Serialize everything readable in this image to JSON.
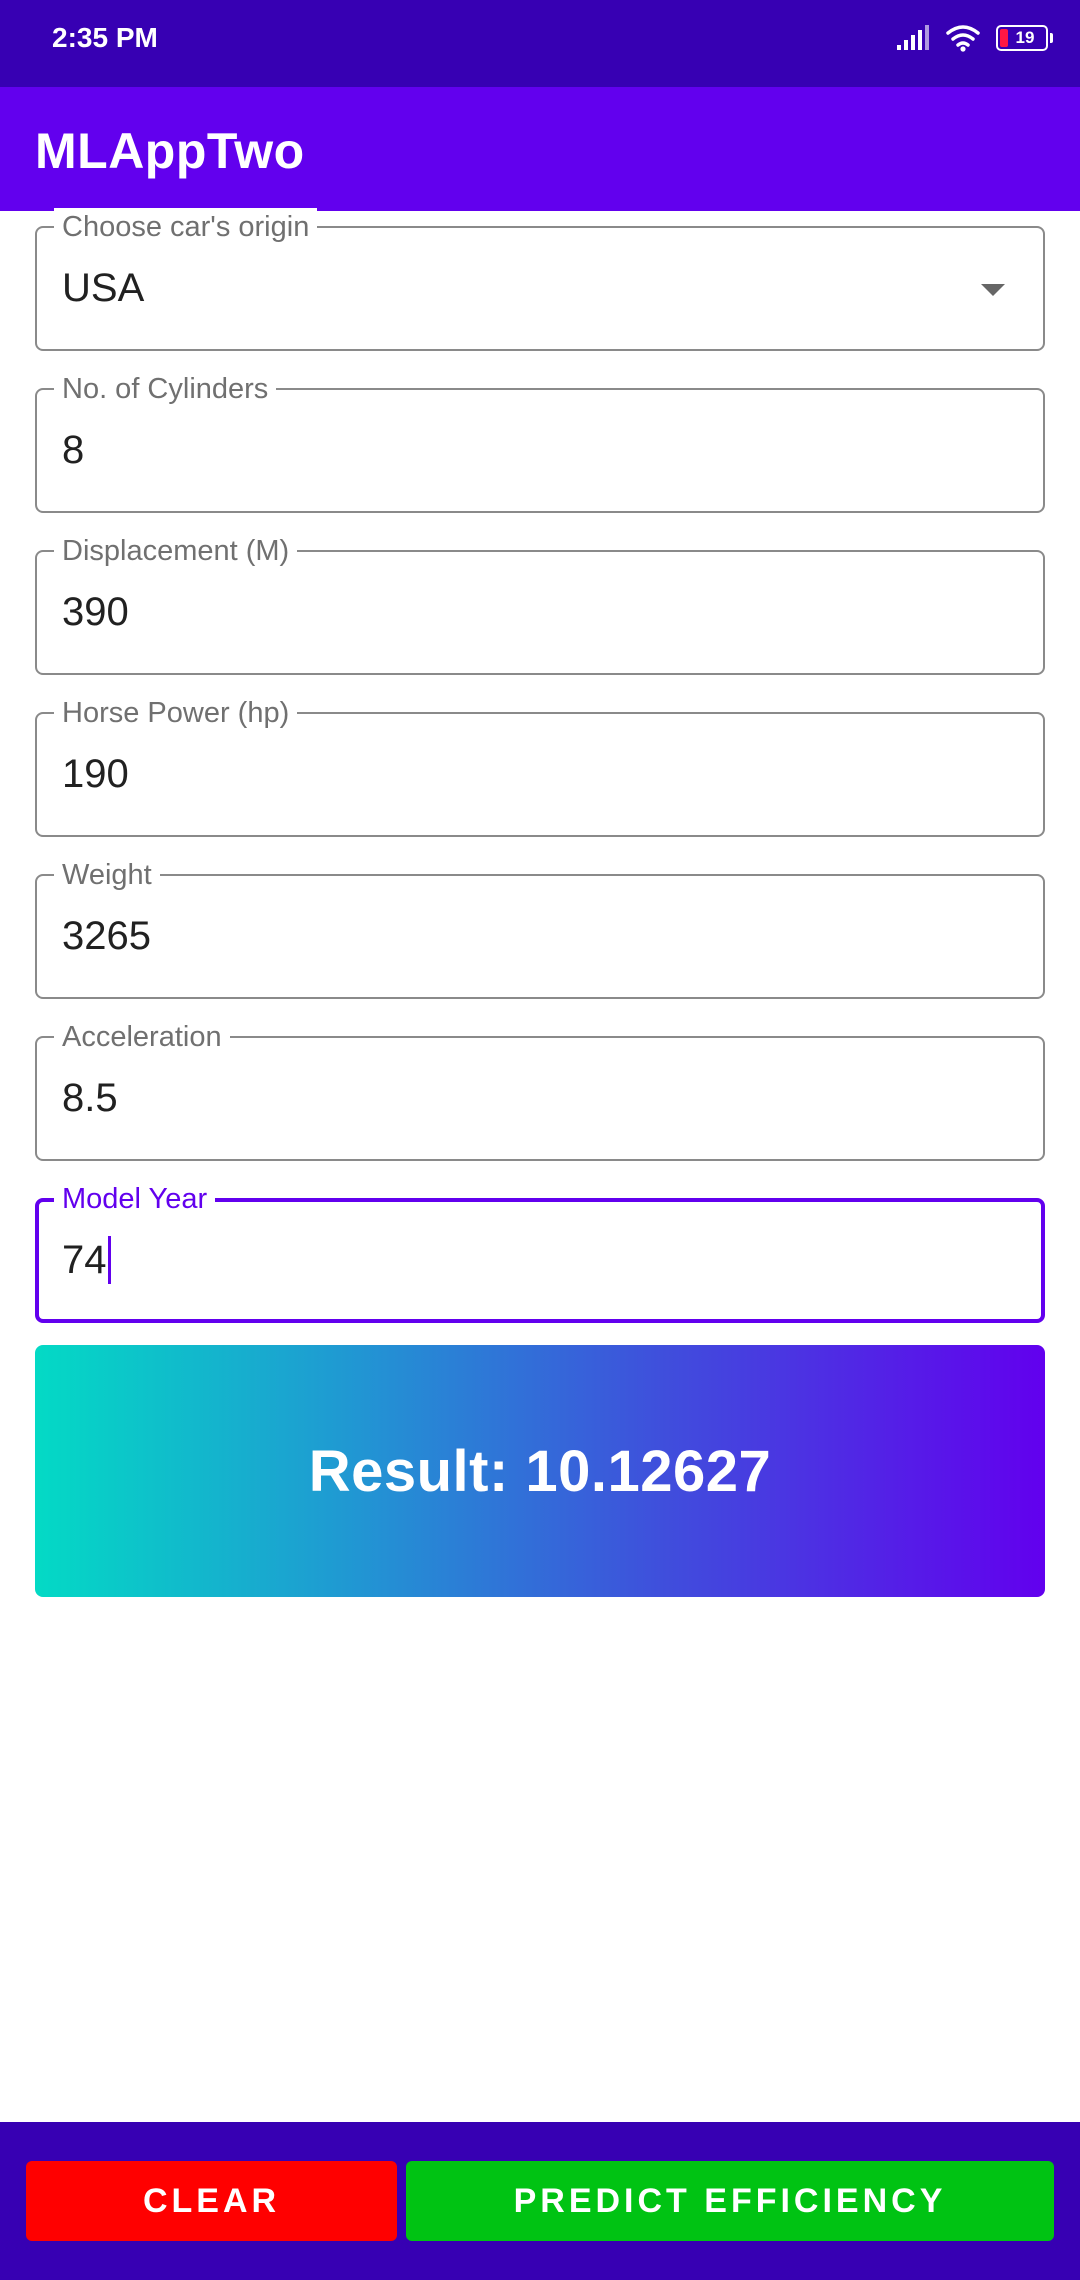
{
  "status_bar": {
    "time": "2:35 PM",
    "battery_level": "19",
    "icons": [
      "signal-icon",
      "wifi-icon",
      "battery-icon"
    ]
  },
  "app_bar": {
    "title": "MLAppTwo"
  },
  "form": {
    "fields": [
      {
        "label": "Choose car's origin",
        "value": "USA",
        "type": "dropdown"
      },
      {
        "label": "No. of Cylinders",
        "value": "8"
      },
      {
        "label": "Displacement (M)",
        "value": "390"
      },
      {
        "label": "Horse Power (hp)",
        "value": "190"
      },
      {
        "label": "Weight",
        "value": "3265"
      },
      {
        "label": "Acceleration",
        "value": "8.5"
      },
      {
        "label": "Model Year",
        "value": "74",
        "focused": true
      }
    ]
  },
  "result": {
    "text": "Result: 10.12627"
  },
  "actions": {
    "clear_label": "CLEAR",
    "predict_label": "PREDICT EFFICIENCY"
  },
  "colors": {
    "status_bar": "#3700b3",
    "primary": "#6200ee",
    "accent": "#03dac5",
    "clear_button": "#ff0000",
    "predict_button": "#00c313"
  }
}
